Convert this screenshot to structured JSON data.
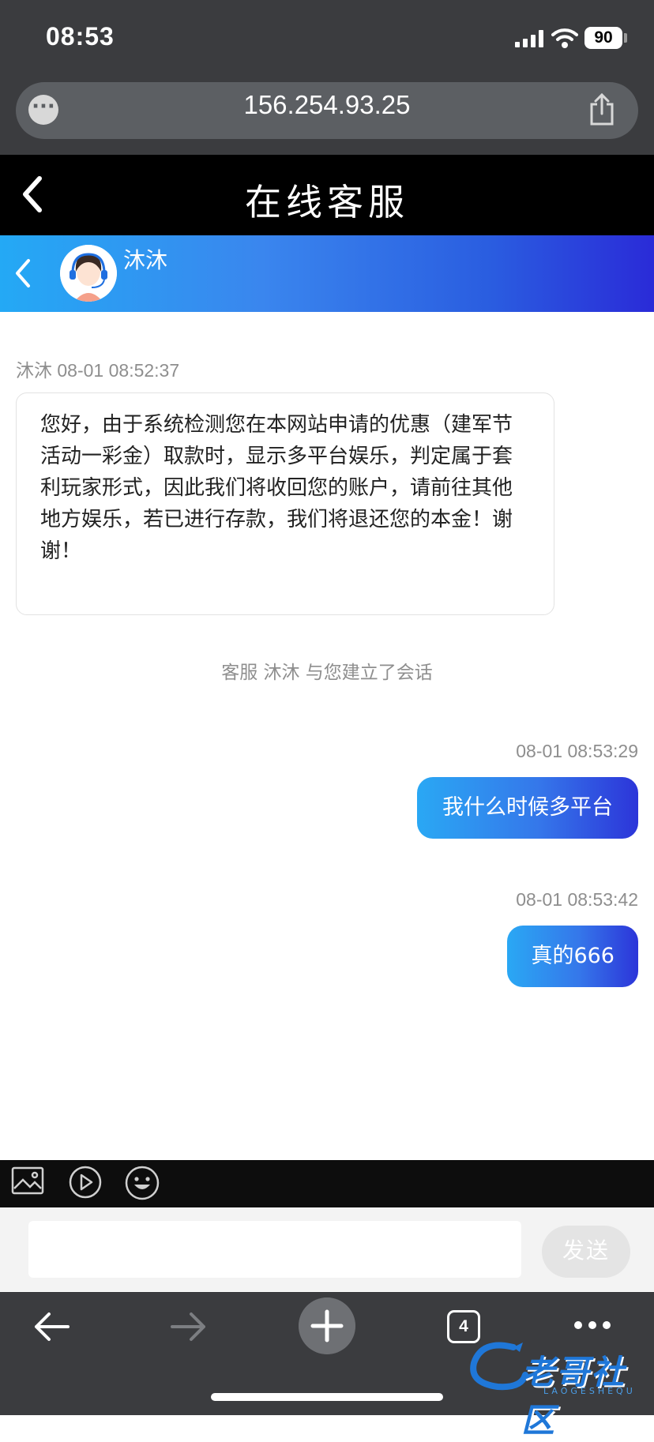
{
  "status_bar": {
    "time": "08:53",
    "battery": "90"
  },
  "browser": {
    "url": "156.254.93.25",
    "menu_icon": "ellipsis-circle-icon",
    "share_icon": "share-icon",
    "tab_count": "4"
  },
  "page_header": {
    "title": "在线客服",
    "back_icon": "chevron-left-icon"
  },
  "agent": {
    "name": "沐沐",
    "back_icon": "chevron-left-icon",
    "avatar_icon": "support-agent-avatar"
  },
  "messages": [
    {
      "from": "agent",
      "sender": "沐沐",
      "time": "08-01 08:52:37",
      "text": "您好，由于系统检测您在本网站申请的优惠（建军节活动一彩金）取款时，显示多平台娱乐，判定属于套利玩家形式，因此我们将收回您的账户，请前往其他地方娱乐，若已进行存款，我们将退还您的本金！谢谢！"
    },
    {
      "from": "system",
      "text": "客服 沐沐 与您建立了会话"
    },
    {
      "from": "user",
      "time": "08-01 08:53:29",
      "text": "我什么时候多平台"
    },
    {
      "from": "user",
      "time": "08-01 08:53:42",
      "text": "真的666"
    }
  ],
  "composer": {
    "value": "",
    "send_label": "发送",
    "tools": [
      "image-icon",
      "video-icon",
      "emoji-icon"
    ]
  },
  "watermark": {
    "text": "老哥社区",
    "sub": "LAOGESHEQU"
  },
  "colors": {
    "chrome": "#3b3c3f",
    "header": "#000000",
    "accent_start": "#24a9f5",
    "accent_end": "#2a2bd8"
  }
}
